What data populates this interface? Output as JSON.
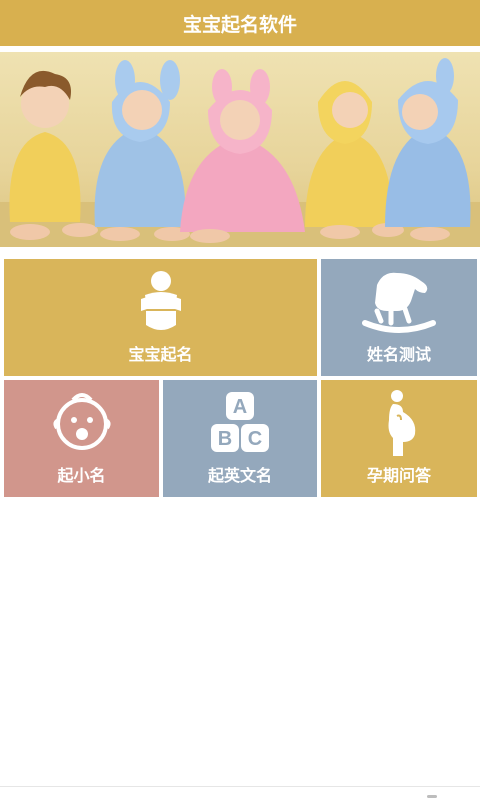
{
  "app": {
    "title": "宝宝起名软件"
  },
  "banner": {
    "image": "five-babies-in-hooded-towels"
  },
  "tiles": [
    {
      "label": "宝宝起名",
      "icon": "baby-icon",
      "color": "#d9b55a"
    },
    {
      "label": "姓名测试",
      "icon": "rocking-horse-icon",
      "color": "#94a8bc"
    },
    {
      "label": "起小名",
      "icon": "baby-face-icon",
      "color": "#d1968c"
    },
    {
      "label": "起英文名",
      "icon": "abc-blocks-icon",
      "color": "#94a8bc"
    },
    {
      "label": "孕期问答",
      "icon": "pregnant-woman-icon",
      "color": "#d9b55a"
    }
  ],
  "colors": {
    "header": "#d8b04f",
    "gold": "#d9b55a",
    "blue": "#94a8bc",
    "rose": "#d1968c"
  }
}
